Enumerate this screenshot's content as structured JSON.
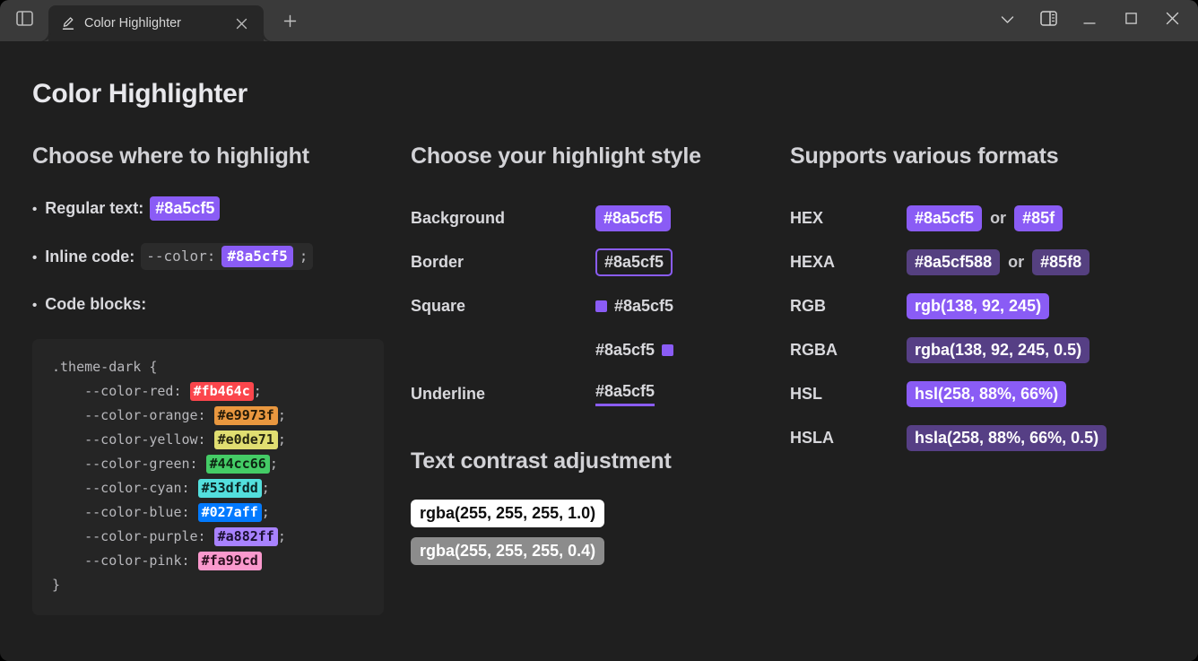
{
  "window": {
    "titlebar": {
      "sidebar_toggle_icon": "sidebar-panel-icon",
      "dropdown_icon": "chevron-down-icon",
      "panel_icon": "right-panel-icon",
      "minimize_icon": "minimize-icon",
      "maximize_icon": "maximize-icon",
      "close_icon": "close-icon"
    },
    "tab": {
      "icon": "highlighter-pen-icon",
      "title": "Color Highlighter",
      "close_icon": "close-icon"
    },
    "new_tab_icon": "plus-icon"
  },
  "page": {
    "title": "Color Highlighter",
    "left": {
      "heading": "Choose where to highlight",
      "bullets": [
        {
          "label": "Regular text:",
          "chip": "#8a5cf5"
        },
        {
          "label": "Inline code:",
          "code_prefix": "--color:",
          "chip": "#8a5cf5",
          "code_suffix": ";"
        },
        {
          "label": "Code blocks:"
        }
      ],
      "code_block": {
        "open": ".theme-dark {",
        "close": "}",
        "lines": [
          {
            "prop": "    --color-red: ",
            "chip": "#fb464c",
            "bg": "#fb464c",
            "fg": "#ffffff",
            "semi": ";"
          },
          {
            "prop": "    --color-orange: ",
            "chip": "#e9973f",
            "bg": "#e9973f",
            "fg": "#241a08",
            "semi": ";"
          },
          {
            "prop": "    --color-yellow: ",
            "chip": "#e0de71",
            "bg": "#e0de71",
            "fg": "#262610",
            "semi": ";"
          },
          {
            "prop": "    --color-green: ",
            "chip": "#44cc66",
            "bg": "#44cc66",
            "fg": "#0d2412",
            "semi": ";"
          },
          {
            "prop": "    --color-cyan: ",
            "chip": "#53dfdd",
            "bg": "#53dfdd",
            "fg": "#0b2423",
            "semi": ";"
          },
          {
            "prop": "    --color-blue: ",
            "chip": "#027aff",
            "bg": "#027aff",
            "fg": "#ffffff",
            "semi": ";"
          },
          {
            "prop": "    --color-purple: ",
            "chip": "#a882ff",
            "bg": "#a882ff",
            "fg": "#1a1030",
            "semi": ";"
          },
          {
            "prop": "    --color-pink: ",
            "chip": "#fa99cd",
            "bg": "#fa99cd",
            "fg": "#2b0f1f",
            "semi": ""
          }
        ]
      }
    },
    "middle": {
      "heading": "Choose your highlight style",
      "rows": [
        {
          "label": "Background",
          "value": "#8a5cf5",
          "style": "background"
        },
        {
          "label": "Border",
          "value": "#8a5cf5",
          "style": "border"
        },
        {
          "label": "Square",
          "value": "#8a5cf5",
          "style": "square-before"
        },
        {
          "label": "",
          "value": "#8a5cf5",
          "style": "square-after"
        },
        {
          "label": "Underline",
          "value": "#8a5cf5",
          "style": "underline"
        }
      ],
      "contrast_heading": "Text contrast adjustment",
      "contrast": [
        {
          "text": "rgba(255, 255, 255, 1.0)",
          "bg": "#ffffff",
          "fg": "#0d0d0d"
        },
        {
          "text": "rgba(255, 255, 255, 0.4)",
          "bg": "#8c8c8c",
          "fg": "#ffffff"
        }
      ]
    },
    "right": {
      "heading": "Supports various formats",
      "or_label": "or",
      "rows": [
        {
          "label": "HEX",
          "chips": [
            "#8a5cf5",
            "#85f"
          ],
          "bgs": [
            "#8a5cf5",
            "#8a5cf5"
          ]
        },
        {
          "label": "HEXA",
          "chips": [
            "#8a5cf588",
            "#85f8"
          ],
          "bgs": [
            "#554080",
            "#554080"
          ]
        },
        {
          "label": "RGB",
          "chips": [
            "rgb(138, 92, 245)"
          ],
          "bgs": [
            "#8a5cf5"
          ]
        },
        {
          "label": "RGBA",
          "chips": [
            "rgba(138, 92, 245, 0.5)"
          ],
          "bgs": [
            "#563f85"
          ]
        },
        {
          "label": "HSL",
          "chips": [
            "hsl(258, 88%, 66%)"
          ],
          "bgs": [
            "#8a5cf5"
          ]
        },
        {
          "label": "HSLA",
          "chips": [
            "hsla(258, 88%, 66%, 0.5)"
          ],
          "bgs": [
            "#563f85"
          ]
        }
      ]
    }
  },
  "colors": {
    "accent": "#8a5cf5",
    "page_bg": "#1f1f1f",
    "titlebar_bg": "#3a3a3a",
    "code_bg": "#252525"
  }
}
